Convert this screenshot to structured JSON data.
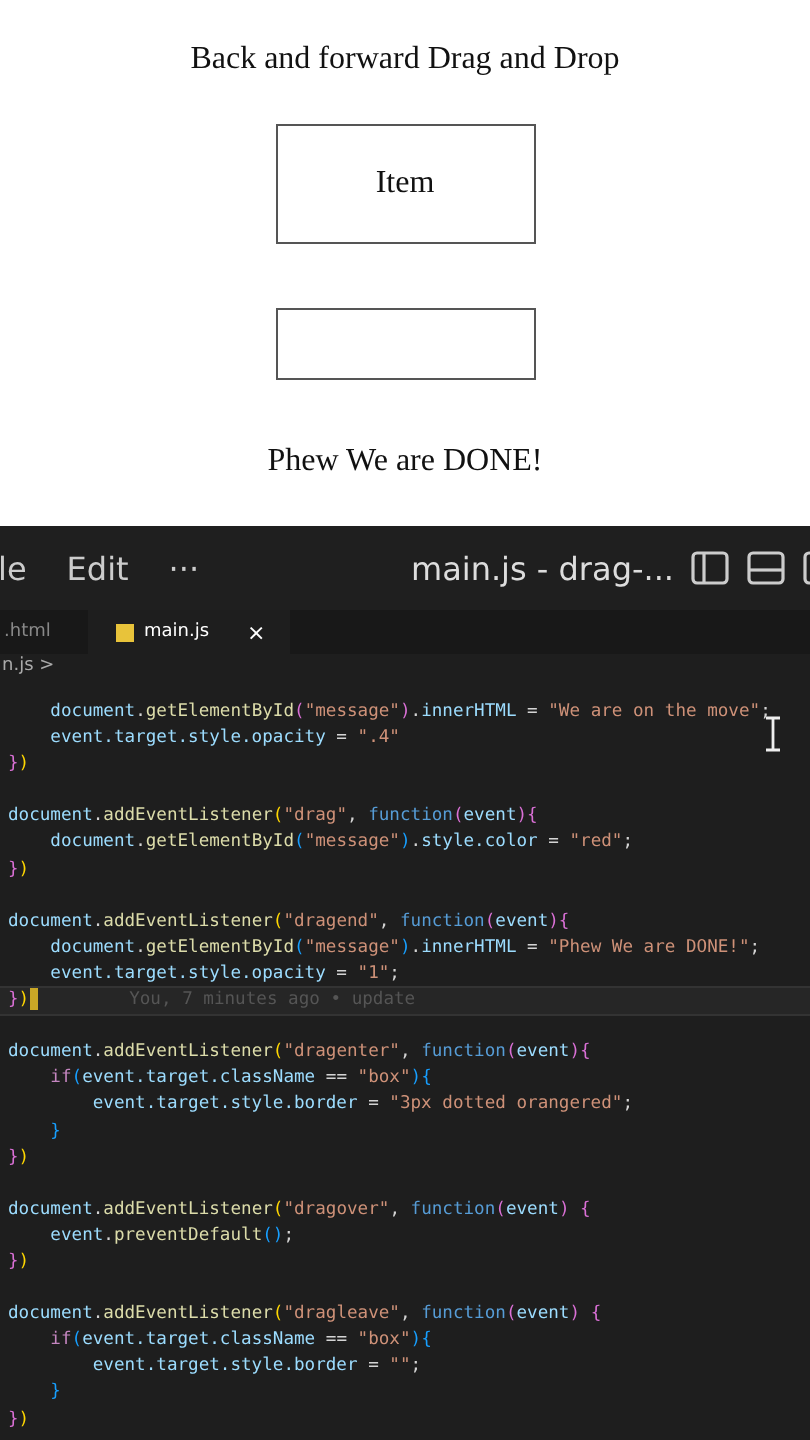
{
  "demo_page": {
    "title": "Back and forward Drag and Drop",
    "drag_item": {
      "label": "Item"
    },
    "message": "Phew We are DONE!"
  },
  "editor": {
    "menu": [
      "le",
      "Edit",
      "···"
    ],
    "window_title": "main.js - drag-...",
    "tabs": [
      {
        "label": ".html",
        "selected": false
      },
      {
        "label": "main.js",
        "selected": true,
        "close": "×"
      }
    ],
    "breadcrumb": "n.js >",
    "lines": [
      {
        "kind": "code",
        "tokens": [
          {
            "kind": "id",
            "text": "    document"
          },
          {
            "kind": "p",
            "text": "."
          },
          {
            "kind": "fn",
            "text": "getElementById"
          },
          {
            "kind": "b2",
            "text": "("
          },
          {
            "kind": "str",
            "text": "\"message\""
          },
          {
            "kind": "b2",
            "text": ")"
          },
          {
            "kind": "p",
            "text": "."
          },
          {
            "kind": "id",
            "text": "innerHTML"
          },
          {
            "kind": "p",
            "text": " = "
          },
          {
            "kind": "str",
            "text": "\"We are on the move\""
          },
          {
            "kind": "p",
            "text": ";"
          }
        ]
      },
      {
        "kind": "code",
        "tokens": [
          {
            "kind": "id",
            "text": "    event.target.style.opacity"
          },
          {
            "kind": "p",
            "text": " = "
          },
          {
            "kind": "str",
            "text": "\".4\""
          }
        ]
      },
      {
        "kind": "code",
        "tokens": [
          {
            "kind": "b2",
            "text": "}"
          },
          {
            "kind": "b1",
            "text": ")"
          }
        ]
      },
      {
        "kind": "blank"
      },
      {
        "kind": "code",
        "tokens": [
          {
            "kind": "id",
            "text": "document"
          },
          {
            "kind": "p",
            "text": "."
          },
          {
            "kind": "fn",
            "text": "addEventListener"
          },
          {
            "kind": "b1",
            "text": "("
          },
          {
            "kind": "str",
            "text": "\"drag\""
          },
          {
            "kind": "p",
            "text": ", "
          },
          {
            "kind": "kw",
            "text": "function"
          },
          {
            "kind": "b2",
            "text": "("
          },
          {
            "kind": "id",
            "text": "event"
          },
          {
            "kind": "b2",
            "text": "){"
          }
        ]
      },
      {
        "kind": "code",
        "tokens": [
          {
            "kind": "id",
            "text": "    document"
          },
          {
            "kind": "p",
            "text": "."
          },
          {
            "kind": "fn",
            "text": "getElementById"
          },
          {
            "kind": "b3",
            "text": "("
          },
          {
            "kind": "str",
            "text": "\"message\""
          },
          {
            "kind": "b3",
            "text": ")"
          },
          {
            "kind": "p",
            "text": "."
          },
          {
            "kind": "id",
            "text": "style.color"
          },
          {
            "kind": "p",
            "text": " = "
          },
          {
            "kind": "str",
            "text": "\"red\""
          },
          {
            "kind": "p",
            "text": ";"
          }
        ]
      },
      {
        "kind": "code",
        "tokens": [
          {
            "kind": "b2",
            "text": "}"
          },
          {
            "kind": "b1",
            "text": ")"
          }
        ]
      },
      {
        "kind": "blank"
      },
      {
        "kind": "code",
        "tokens": [
          {
            "kind": "id",
            "text": "document"
          },
          {
            "kind": "p",
            "text": "."
          },
          {
            "kind": "fn",
            "text": "addEventListener"
          },
          {
            "kind": "b1",
            "text": "("
          },
          {
            "kind": "str",
            "text": "\"dragend\""
          },
          {
            "kind": "p",
            "text": ", "
          },
          {
            "kind": "kw",
            "text": "function"
          },
          {
            "kind": "b2",
            "text": "("
          },
          {
            "kind": "id",
            "text": "event"
          },
          {
            "kind": "b2",
            "text": "){"
          }
        ]
      },
      {
        "kind": "code",
        "tokens": [
          {
            "kind": "id",
            "text": "    document"
          },
          {
            "kind": "p",
            "text": "."
          },
          {
            "kind": "fn",
            "text": "getElementById"
          },
          {
            "kind": "b3",
            "text": "("
          },
          {
            "kind": "str",
            "text": "\"message\""
          },
          {
            "kind": "b3",
            "text": ")"
          },
          {
            "kind": "p",
            "text": "."
          },
          {
            "kind": "id",
            "text": "innerHTML"
          },
          {
            "kind": "p",
            "text": " = "
          },
          {
            "kind": "str",
            "text": "\"Phew We are DONE!\""
          },
          {
            "kind": "p",
            "text": ";"
          }
        ]
      },
      {
        "kind": "code",
        "tokens": [
          {
            "kind": "id",
            "text": "    event.target.style.opacity"
          },
          {
            "kind": "p",
            "text": " = "
          },
          {
            "kind": "str",
            "text": "\"1\""
          },
          {
            "kind": "p",
            "text": ";"
          }
        ]
      },
      {
        "kind": "code",
        "current": true,
        "blame": "You, 7 minutes ago • update",
        "tokens": [
          {
            "kind": "b2",
            "text": "}"
          },
          {
            "kind": "b1",
            "text": ")"
          }
        ]
      },
      {
        "kind": "blank"
      },
      {
        "kind": "code",
        "tokens": [
          {
            "kind": "id",
            "text": "document"
          },
          {
            "kind": "p",
            "text": "."
          },
          {
            "kind": "fn",
            "text": "addEventListener"
          },
          {
            "kind": "b1",
            "text": "("
          },
          {
            "kind": "str",
            "text": "\"dragenter\""
          },
          {
            "kind": "p",
            "text": ", "
          },
          {
            "kind": "kw",
            "text": "function"
          },
          {
            "kind": "b2",
            "text": "("
          },
          {
            "kind": "id",
            "text": "event"
          },
          {
            "kind": "b2",
            "text": "){"
          }
        ]
      },
      {
        "kind": "code",
        "tokens": [
          {
            "kind": "ctl",
            "text": "    if"
          },
          {
            "kind": "b3",
            "text": "("
          },
          {
            "kind": "id",
            "text": "event.target.className"
          },
          {
            "kind": "p",
            "text": " == "
          },
          {
            "kind": "str",
            "text": "\"box\""
          },
          {
            "kind": "b3",
            "text": "){"
          }
        ]
      },
      {
        "kind": "code",
        "tokens": [
          {
            "kind": "id",
            "text": "        event.target.style.border"
          },
          {
            "kind": "p",
            "text": " = "
          },
          {
            "kind": "str",
            "text": "\"3px dotted orangered\""
          },
          {
            "kind": "p",
            "text": ";"
          }
        ]
      },
      {
        "kind": "code",
        "tokens": [
          {
            "kind": "b3",
            "text": "    }"
          }
        ]
      },
      {
        "kind": "code",
        "tokens": [
          {
            "kind": "b2",
            "text": "}"
          },
          {
            "kind": "b1",
            "text": ")"
          }
        ]
      },
      {
        "kind": "blank"
      },
      {
        "kind": "code",
        "tokens": [
          {
            "kind": "id",
            "text": "document"
          },
          {
            "kind": "p",
            "text": "."
          },
          {
            "kind": "fn",
            "text": "addEventListener"
          },
          {
            "kind": "b1",
            "text": "("
          },
          {
            "kind": "str",
            "text": "\"dragover\""
          },
          {
            "kind": "p",
            "text": ", "
          },
          {
            "kind": "kw",
            "text": "function"
          },
          {
            "kind": "b2",
            "text": "("
          },
          {
            "kind": "id",
            "text": "event"
          },
          {
            "kind": "b2",
            "text": ") {"
          }
        ]
      },
      {
        "kind": "code",
        "tokens": [
          {
            "kind": "id",
            "text": "    event"
          },
          {
            "kind": "p",
            "text": "."
          },
          {
            "kind": "fn",
            "text": "preventDefault"
          },
          {
            "kind": "b3",
            "text": "()"
          },
          {
            "kind": "p",
            "text": ";"
          }
        ]
      },
      {
        "kind": "code",
        "tokens": [
          {
            "kind": "b2",
            "text": "}"
          },
          {
            "kind": "b1",
            "text": ")"
          }
        ]
      },
      {
        "kind": "blank"
      },
      {
        "kind": "code",
        "tokens": [
          {
            "kind": "id",
            "text": "document"
          },
          {
            "kind": "p",
            "text": "."
          },
          {
            "kind": "fn",
            "text": "addEventListener"
          },
          {
            "kind": "b1",
            "text": "("
          },
          {
            "kind": "str",
            "text": "\"dragleave\""
          },
          {
            "kind": "p",
            "text": ", "
          },
          {
            "kind": "kw",
            "text": "function"
          },
          {
            "kind": "b2",
            "text": "("
          },
          {
            "kind": "id",
            "text": "event"
          },
          {
            "kind": "b2",
            "text": ") {"
          }
        ]
      },
      {
        "kind": "code",
        "tokens": [
          {
            "kind": "ctl",
            "text": "    if"
          },
          {
            "kind": "b3",
            "text": "("
          },
          {
            "kind": "id",
            "text": "event.target.className"
          },
          {
            "kind": "p",
            "text": " == "
          },
          {
            "kind": "str",
            "text": "\"box\""
          },
          {
            "kind": "b3",
            "text": "){"
          }
        ]
      },
      {
        "kind": "code",
        "tokens": [
          {
            "kind": "id",
            "text": "        event.target.style.border"
          },
          {
            "kind": "p",
            "text": " = "
          },
          {
            "kind": "str",
            "text": "\"\""
          },
          {
            "kind": "p",
            "text": ";"
          }
        ]
      },
      {
        "kind": "code",
        "tokens": [
          {
            "kind": "b3",
            "text": "    }"
          }
        ]
      },
      {
        "kind": "code",
        "tokens": [
          {
            "kind": "b2",
            "text": "}"
          },
          {
            "kind": "b1",
            "text": ")"
          }
        ]
      }
    ]
  }
}
